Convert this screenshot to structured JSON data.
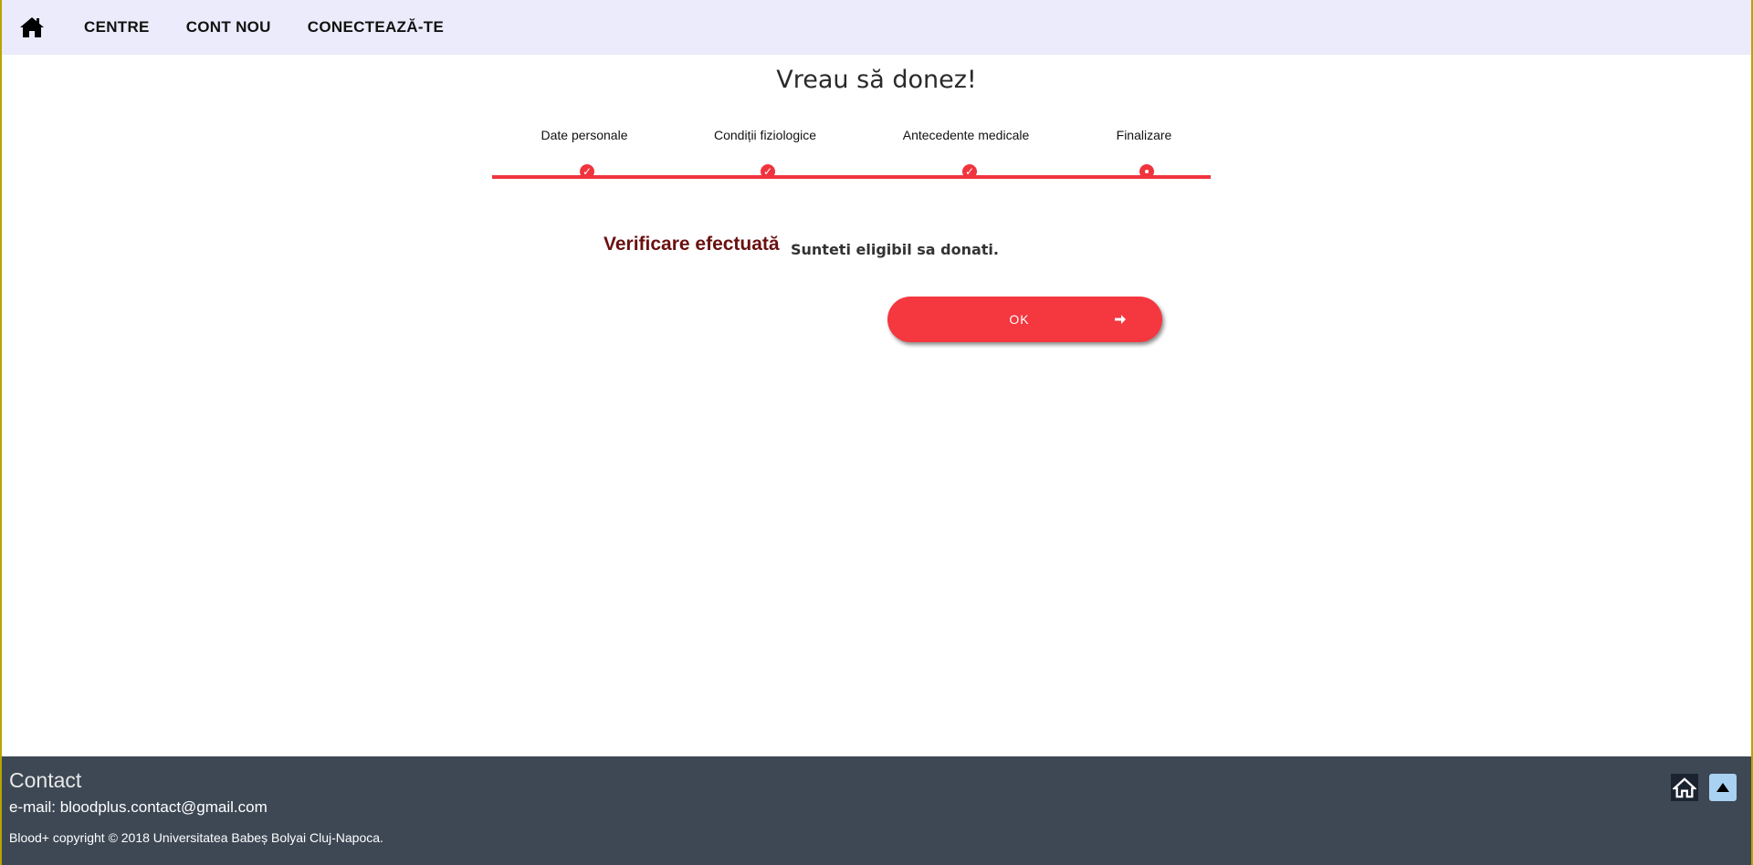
{
  "nav": {
    "home_icon": "home-icon",
    "links": [
      "CENTRE",
      "CONT NOU",
      "CONECTEAZĂ-TE"
    ]
  },
  "page": {
    "title": "Vreau să donez!"
  },
  "stepper": {
    "steps": [
      {
        "label": "Date personale",
        "state": "done"
      },
      {
        "label": "Condiții fiziologice",
        "state": "done"
      },
      {
        "label": "Antecedente medicale",
        "state": "done"
      },
      {
        "label": "Finalizare",
        "state": "active"
      }
    ],
    "check_glyph": "✓"
  },
  "verification": {
    "title": "Verificare efectuată",
    "message": "Sunteti eligibil sa donati."
  },
  "ok_button": {
    "label": "OK",
    "icon": "arrow-right-icon"
  },
  "footer": {
    "title": "Contact",
    "email": "e-mail: bloodplus.contact@gmail.com",
    "copyright": "Blood+ copyright © 2018 Universitatea Babeș Bolyai Cluj-Napoca.",
    "home_icon": "home-icon",
    "top_icon": "scroll-top-icon"
  },
  "colors": {
    "nav_bg": "#ebebfb",
    "accent": "#f0343e",
    "footer_bg": "#3d4854",
    "verify_title": "#6b1010"
  }
}
